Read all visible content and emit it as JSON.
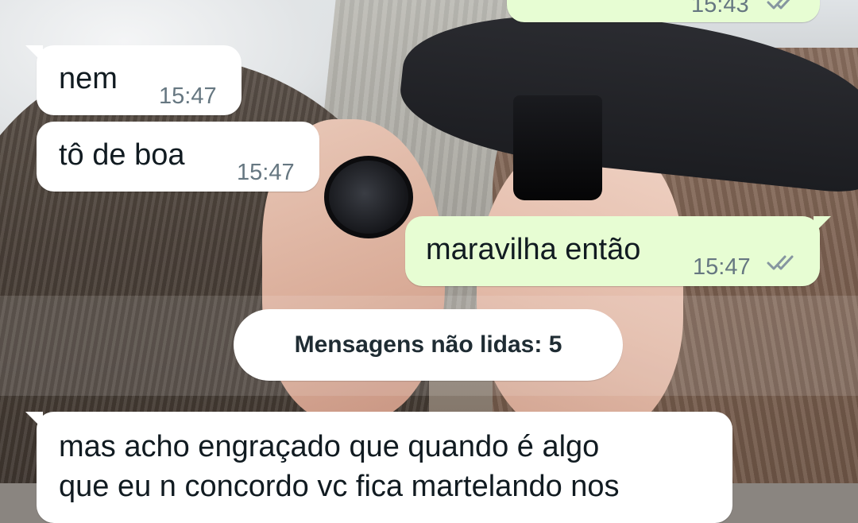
{
  "wallpaper": {
    "icon": "photo-wallpaper"
  },
  "messages": [
    {
      "direction": "outgoing",
      "text": "",
      "time": "15:43",
      "status": "read"
    },
    {
      "direction": "incoming",
      "text": "nem",
      "time": "15:47"
    },
    {
      "direction": "incoming",
      "text": "tô de boa",
      "time": "15:47"
    },
    {
      "direction": "outgoing",
      "text": "maravilha então",
      "time": "15:47",
      "status": "read"
    }
  ],
  "unread_divider": {
    "label": "Mensagens não lidas: 5"
  },
  "unread_messages": [
    {
      "direction": "incoming",
      "line1": "mas acho engraçado que quando é algo",
      "line2": "que eu n concordo vc fica martelando nos"
    }
  ],
  "colors": {
    "incoming_bubble": "#ffffff",
    "outgoing_bubble": "#e7fdd3",
    "timestamp": "#667781",
    "read_ticks": "#8696a0",
    "text": "#111b21"
  }
}
